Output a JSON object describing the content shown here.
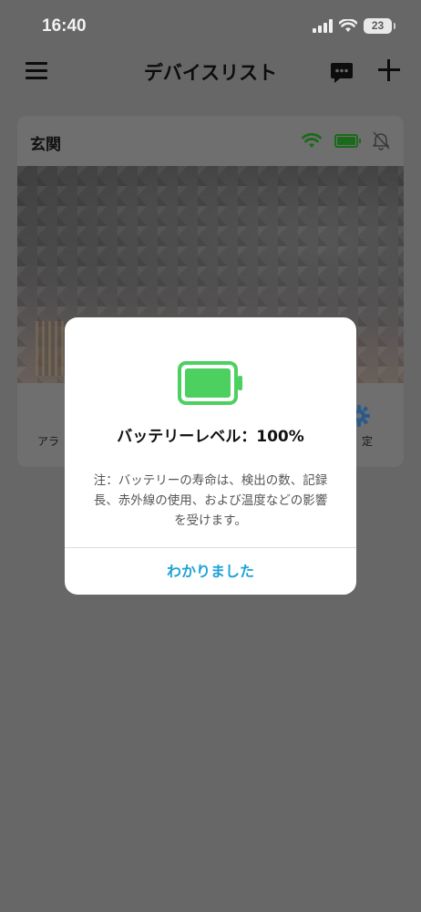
{
  "status_bar": {
    "time": "16:40",
    "battery_level": "23"
  },
  "nav": {
    "title": "デバイスリスト"
  },
  "device": {
    "name": "玄関",
    "actions": {
      "left_label": "アラ",
      "right_label": "定"
    }
  },
  "dialog": {
    "title": "バッテリーレベル：100%",
    "note": "注：バッテリーの寿命は、検出の数、記録長、赤外線の使用、および温度などの影響を受けます。",
    "ok_label": "わかりました",
    "battery_percent": 100
  },
  "colors": {
    "battery_green": "#4cd060",
    "accent_blue": "#1fa3d8",
    "overlay": "#676767"
  }
}
